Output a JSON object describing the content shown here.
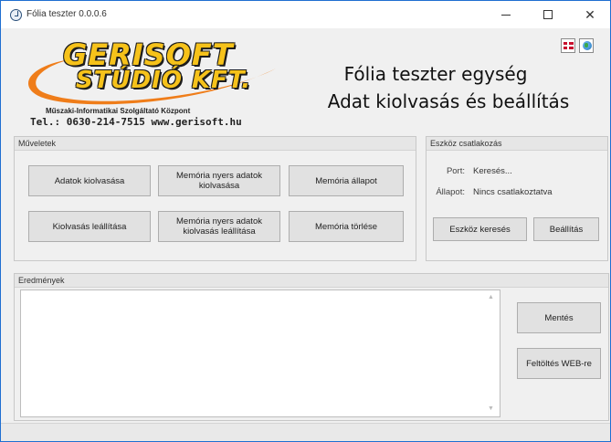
{
  "window": {
    "title": "Fólia teszter 0.0.0.6",
    "controls": {
      "minimize": "",
      "maximize": "",
      "close": "✕"
    }
  },
  "logo": {
    "line1": "GERISOFT",
    "line2": "STÚDIÓ KFT.",
    "subtitle": "Műszaki-Informatikai Szolgáltató Központ",
    "contact": "Tel.: 0630-214-7515   www.gerisoft.hu",
    "colors": {
      "letters": "#f6c21a",
      "swoosh": "#ef7d1a",
      "outline": "#1d1d1d"
    }
  },
  "header": {
    "line1": "Fólia teszter egység",
    "line2": "Adat kiolvasás és beállítás"
  },
  "language_buttons": [
    {
      "icon": "hungarian-flag-icon"
    },
    {
      "icon": "globe-icon"
    }
  ],
  "operations": {
    "title": "Műveletek",
    "buttons": [
      "Adatok kiolvasása",
      "Memória nyers adatok kiolvasása",
      "Memória állapot",
      "Kiolvasás leállítása",
      "Memória nyers adatok kiolvasás leállítása",
      "Memória törlése"
    ]
  },
  "device": {
    "title": "Eszköz csatlakozás",
    "port_label": "Port:",
    "port_value": "Keresés...",
    "state_label": "Állapot:",
    "state_value": "Nincs csatlakoztatva",
    "search_button": "Eszköz keresés",
    "settings_button": "Beállítás"
  },
  "results": {
    "title": "Eredmények",
    "content": "",
    "save_button": "Mentés",
    "upload_button": "Feltöltés WEB-re"
  }
}
